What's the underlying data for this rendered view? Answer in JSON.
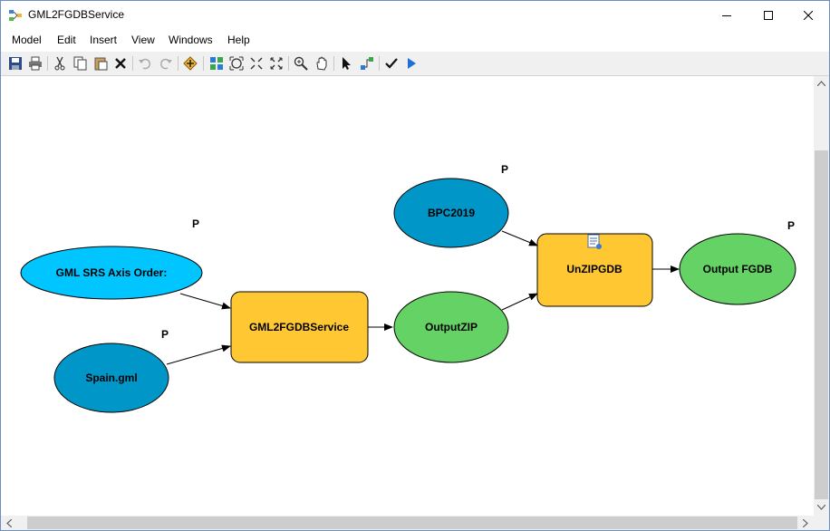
{
  "window": {
    "title": "GML2FGDBService"
  },
  "menu": [
    {
      "id": "model",
      "label": "Model"
    },
    {
      "id": "edit",
      "label": "Edit"
    },
    {
      "id": "insert",
      "label": "Insert"
    },
    {
      "id": "view",
      "label": "View"
    },
    {
      "id": "windows",
      "label": "Windows"
    },
    {
      "id": "help",
      "label": "Help"
    }
  ],
  "toolbar": {
    "icons": [
      "save-icon",
      "print-icon",
      "cut-icon",
      "copy-icon",
      "paste-icon",
      "delete-icon",
      "undo-icon",
      "redo-icon",
      "add-data-icon",
      "auto-layout-icon",
      "full-extent-icon",
      "zoom-in-fixed-icon",
      "zoom-out-fixed-icon",
      "zoom-icon",
      "pan-icon",
      "select-icon",
      "connect-icon",
      "validate-icon",
      "run-icon"
    ]
  },
  "model": {
    "p_marker": "P",
    "nodes": {
      "gml_srs": {
        "label": "GML SRS Axis Order:",
        "kind": "variable",
        "color": "#00c5ff"
      },
      "spain": {
        "label": "Spain.gml",
        "kind": "input",
        "color": "#0096c8"
      },
      "gml2fgdb": {
        "label": "GML2FGDBService",
        "kind": "tool",
        "color": "#ffc832"
      },
      "outputzip": {
        "label": "OutputZIP",
        "kind": "derived",
        "color": "#64d264"
      },
      "bpc2019": {
        "label": "BPC2019",
        "kind": "input",
        "color": "#0096c8"
      },
      "unzipgdb": {
        "label": "UnZIPGDB",
        "kind": "tool",
        "color": "#ffc832"
      },
      "outputfgdb": {
        "label": "Output FGDB",
        "kind": "derived",
        "color": "#64d264"
      }
    }
  }
}
